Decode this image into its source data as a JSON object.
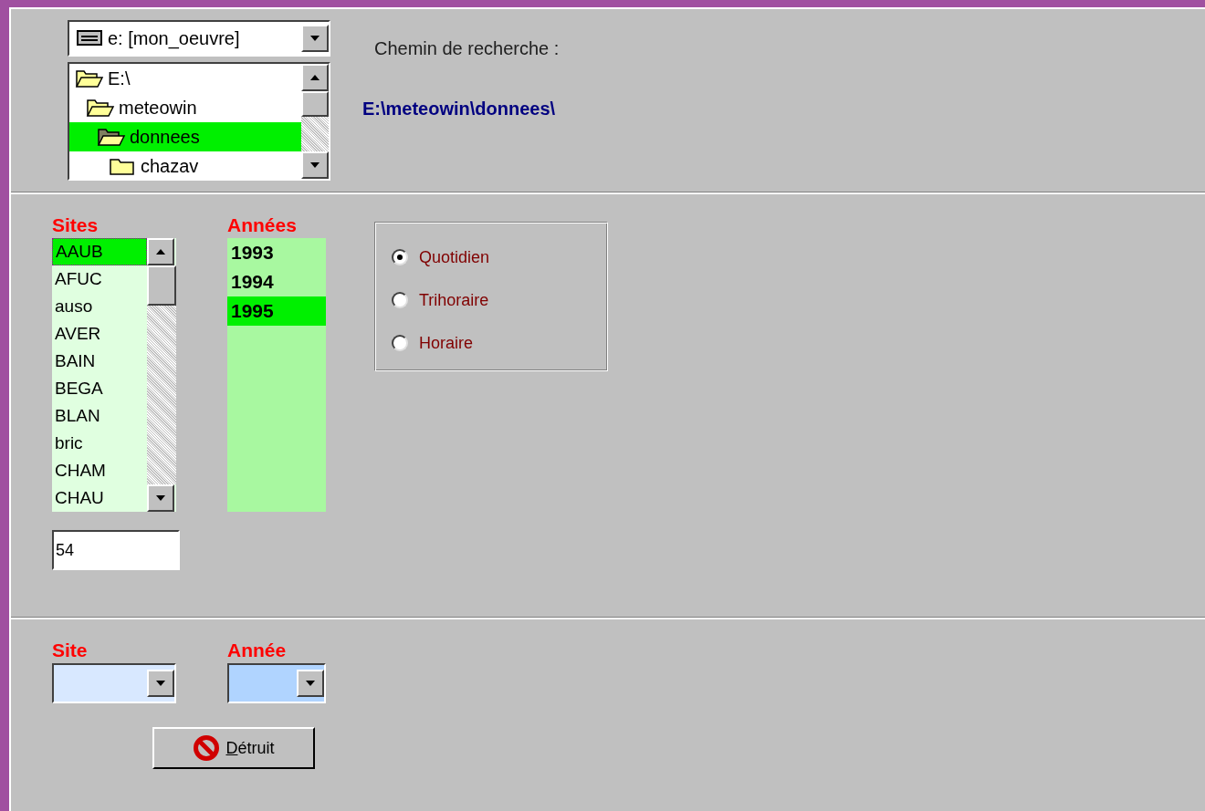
{
  "drive_select": {
    "value": "e: [mon_oeuvre]"
  },
  "folder_tree": [
    {
      "label": "E:\\",
      "expanded": true,
      "selected": false,
      "children": [
        {
          "label": "meteowin",
          "expanded": true,
          "selected": false,
          "children": [
            {
              "label": "donnees",
              "expanded": true,
              "selected": true,
              "children": [
                {
                  "label": "chazav",
                  "expanded": false,
                  "selected": false
                }
              ]
            }
          ]
        }
      ]
    }
  ],
  "search_path": {
    "label": "Chemin de recherche :",
    "value": "E:\\meteowin\\donnees\\"
  },
  "sites": {
    "label": "Sites",
    "items": [
      {
        "label": "AAUB",
        "selected": true
      },
      {
        "label": "AFUC",
        "selected": false
      },
      {
        "label": "auso",
        "selected": false
      },
      {
        "label": "AVER",
        "selected": false
      },
      {
        "label": "BAIN",
        "selected": false
      },
      {
        "label": "BEGA",
        "selected": false
      },
      {
        "label": "BLAN",
        "selected": false
      },
      {
        "label": "bric",
        "selected": false
      },
      {
        "label": "CHAM",
        "selected": false
      },
      {
        "label": "CHAU",
        "selected": false
      }
    ],
    "count": "54"
  },
  "years": {
    "label": "Années",
    "items": [
      {
        "label": "1993",
        "selected": false
      },
      {
        "label": "1994",
        "selected": false
      },
      {
        "label": "1995",
        "selected": true
      }
    ]
  },
  "frequency": [
    {
      "label": "Quotidien",
      "selected": true
    },
    {
      "label": "Trihoraire",
      "selected": false
    },
    {
      "label": "Horaire",
      "selected": false
    }
  ],
  "delete_form": {
    "site_label": "Site",
    "year_label": "Année",
    "button": "Détruit"
  }
}
